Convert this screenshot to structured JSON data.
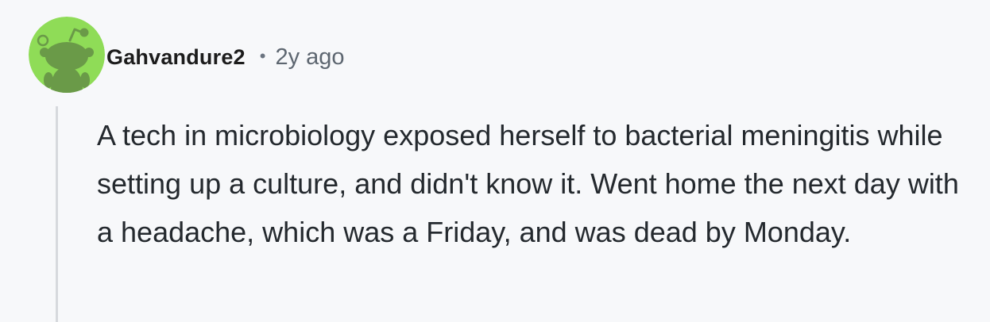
{
  "comment": {
    "author": "Gahvandure2",
    "separator": "•",
    "time_ago": "2y ago",
    "body": "A tech in microbiology exposed herself to bacterial meningitis while setting up a culture, and didn't know it. Went home the next day with a headache, which was a Friday, and was dead by Monday.",
    "avatar_icon": "snoo-avatar-icon"
  },
  "colors": {
    "page_background": "#f7f8fa",
    "avatar_background": "#8fdc57",
    "avatar_figure": "#6a9a48",
    "username_text": "#1c1c1c",
    "timestamp_text": "#5d6670",
    "body_text": "#24292e",
    "thread_line": "#d6d9dd"
  }
}
